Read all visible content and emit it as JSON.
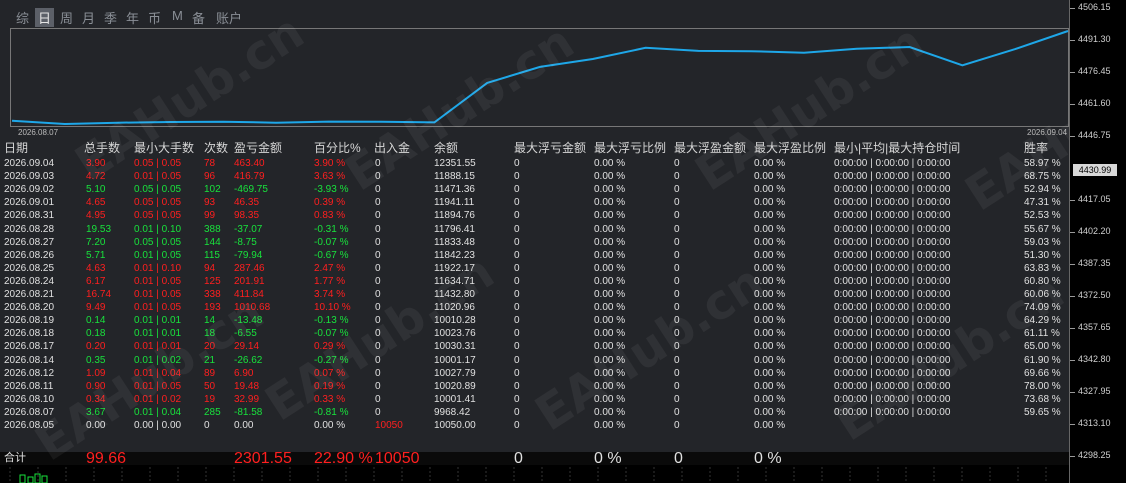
{
  "tabs": [
    "综",
    "日",
    "周",
    "月",
    "季",
    "年",
    "币",
    "M",
    "备",
    "账户"
  ],
  "active_tab": "日",
  "chart": {
    "start_date": "2026.08.07",
    "end_date": "2026.09.04",
    "line_color": "#1ea7e8"
  },
  "columns": {
    "date": "日期",
    "total_lots": "总手数",
    "min_max_lots": "最小大手数",
    "count": "次数",
    "pnl": "盈亏金额",
    "pct": "百分比%",
    "inout": "出入金",
    "balance": "余额",
    "max_float_loss": "最大浮亏金额",
    "max_float_loss_pct": "最大浮亏比例",
    "max_float_profit": "最大浮盈金额",
    "max_float_profit_pct": "最大浮盈比例",
    "hold_time": "最小|平均|最大持仓时间",
    "win_rate": "胜率"
  },
  "rows": [
    {
      "date": "2026.09.04",
      "lots": "3.90",
      "minmax": "0.05 | 0.05",
      "count": "78",
      "pnl": "463.40",
      "pct": "3.90 %",
      "inout": "0",
      "balance": "12351.55",
      "mfl": "0",
      "mflp": "0.00 %",
      "mfp": "0",
      "mfpp": "0.00 %",
      "hold": "0:00:00 | 0:00:00 | 0:00:00",
      "win": "58.97 %",
      "sign": "pos"
    },
    {
      "date": "2026.09.03",
      "lots": "4.72",
      "minmax": "0.01 | 0.05",
      "count": "96",
      "pnl": "416.79",
      "pct": "3.63 %",
      "inout": "0",
      "balance": "11888.15",
      "mfl": "0",
      "mflp": "0.00 %",
      "mfp": "0",
      "mfpp": "0.00 %",
      "hold": "0:00:00 | 0:00:00 | 0:00:00",
      "win": "68.75 %",
      "sign": "pos"
    },
    {
      "date": "2026.09.02",
      "lots": "5.10",
      "minmax": "0.05 | 0.05",
      "count": "102",
      "pnl": "-469.75",
      "pct": "-3.93 %",
      "inout": "0",
      "balance": "11471.36",
      "mfl": "0",
      "mflp": "0.00 %",
      "mfp": "0",
      "mfpp": "0.00 %",
      "hold": "0:00:00 | 0:00:00 | 0:00:00",
      "win": "52.94 %",
      "sign": "neg"
    },
    {
      "date": "2026.09.01",
      "lots": "4.65",
      "minmax": "0.05 | 0.05",
      "count": "93",
      "pnl": "46.35",
      "pct": "0.39 %",
      "inout": "0",
      "balance": "11941.11",
      "mfl": "0",
      "mflp": "0.00 %",
      "mfp": "0",
      "mfpp": "0.00 %",
      "hold": "0:00:00 | 0:00:00 | 0:00:00",
      "win": "47.31 %",
      "sign": "pos"
    },
    {
      "date": "2026.08.31",
      "lots": "4.95",
      "minmax": "0.05 | 0.05",
      "count": "99",
      "pnl": "98.35",
      "pct": "0.83 %",
      "inout": "0",
      "balance": "11894.76",
      "mfl": "0",
      "mflp": "0.00 %",
      "mfp": "0",
      "mfpp": "0.00 %",
      "hold": "0:00:00 | 0:00:00 | 0:00:00",
      "win": "52.53 %",
      "sign": "pos"
    },
    {
      "date": "2026.08.28",
      "lots": "19.53",
      "minmax": "0.01 | 0.10",
      "count": "388",
      "pnl": "-37.07",
      "pct": "-0.31 %",
      "inout": "0",
      "balance": "11796.41",
      "mfl": "0",
      "mflp": "0.00 %",
      "mfp": "0",
      "mfpp": "0.00 %",
      "hold": "0:00:00 | 0:00:00 | 0:00:00",
      "win": "55.67 %",
      "sign": "neg"
    },
    {
      "date": "2026.08.27",
      "lots": "7.20",
      "minmax": "0.05 | 0.05",
      "count": "144",
      "pnl": "-8.75",
      "pct": "-0.07 %",
      "inout": "0",
      "balance": "11833.48",
      "mfl": "0",
      "mflp": "0.00 %",
      "mfp": "0",
      "mfpp": "0.00 %",
      "hold": "0:00:00 | 0:00:00 | 0:00:00",
      "win": "59.03 %",
      "sign": "neg"
    },
    {
      "date": "2026.08.26",
      "lots": "5.71",
      "minmax": "0.01 | 0.05",
      "count": "115",
      "pnl": "-79.94",
      "pct": "-0.67 %",
      "inout": "0",
      "balance": "11842.23",
      "mfl": "0",
      "mflp": "0.00 %",
      "mfp": "0",
      "mfpp": "0.00 %",
      "hold": "0:00:00 | 0:00:00 | 0:00:00",
      "win": "51.30 %",
      "sign": "neg"
    },
    {
      "date": "2026.08.25",
      "lots": "4.63",
      "minmax": "0.01 | 0.10",
      "count": "94",
      "pnl": "287.46",
      "pct": "2.47 %",
      "inout": "0",
      "balance": "11922.17",
      "mfl": "0",
      "mflp": "0.00 %",
      "mfp": "0",
      "mfpp": "0.00 %",
      "hold": "0:00:00 | 0:00:00 | 0:00:00",
      "win": "63.83 %",
      "sign": "pos"
    },
    {
      "date": "2026.08.24",
      "lots": "6.17",
      "minmax": "0.01 | 0.05",
      "count": "125",
      "pnl": "201.91",
      "pct": "1.77 %",
      "inout": "0",
      "balance": "11634.71",
      "mfl": "0",
      "mflp": "0.00 %",
      "mfp": "0",
      "mfpp": "0.00 %",
      "hold": "0:00:00 | 0:00:00 | 0:00:00",
      "win": "60.80 %",
      "sign": "pos"
    },
    {
      "date": "2026.08.21",
      "lots": "16.74",
      "minmax": "0.01 | 0.05",
      "count": "338",
      "pnl": "411.84",
      "pct": "3.74 %",
      "inout": "0",
      "balance": "11432.80",
      "mfl": "0",
      "mflp": "0.00 %",
      "mfp": "0",
      "mfpp": "0.00 %",
      "hold": "0:00:00 | 0:00:00 | 0:00:00",
      "win": "60.06 %",
      "sign": "pos"
    },
    {
      "date": "2026.08.20",
      "lots": "9.49",
      "minmax": "0.01 | 0.05",
      "count": "193",
      "pnl": "1010.68",
      "pct": "10.10 %",
      "inout": "0",
      "balance": "11020.96",
      "mfl": "0",
      "mflp": "0.00 %",
      "mfp": "0",
      "mfpp": "0.00 %",
      "hold": "0:00:00 | 0:00:00 | 0:00:00",
      "win": "74.09 %",
      "sign": "pos"
    },
    {
      "date": "2026.08.19",
      "lots": "0.14",
      "minmax": "0.01 | 0.01",
      "count": "14",
      "pnl": "-13.48",
      "pct": "-0.13 %",
      "inout": "0",
      "balance": "10010.28",
      "mfl": "0",
      "mflp": "0.00 %",
      "mfp": "0",
      "mfpp": "0.00 %",
      "hold": "0:00:00 | 0:00:00 | 0:00:00",
      "win": "64.29 %",
      "sign": "neg"
    },
    {
      "date": "2026.08.18",
      "lots": "0.18",
      "minmax": "0.01 | 0.01",
      "count": "18",
      "pnl": "-6.55",
      "pct": "-0.07 %",
      "inout": "0",
      "balance": "10023.76",
      "mfl": "0",
      "mflp": "0.00 %",
      "mfp": "0",
      "mfpp": "0.00 %",
      "hold": "0:00:00 | 0:00:00 | 0:00:00",
      "win": "61.11 %",
      "sign": "neg"
    },
    {
      "date": "2026.08.17",
      "lots": "0.20",
      "minmax": "0.01 | 0.01",
      "count": "20",
      "pnl": "29.14",
      "pct": "0.29 %",
      "inout": "0",
      "balance": "10030.31",
      "mfl": "0",
      "mflp": "0.00 %",
      "mfp": "0",
      "mfpp": "0.00 %",
      "hold": "0:00:00 | 0:00:00 | 0:00:00",
      "win": "65.00 %",
      "sign": "pos"
    },
    {
      "date": "2026.08.14",
      "lots": "0.35",
      "minmax": "0.01 | 0.02",
      "count": "21",
      "pnl": "-26.62",
      "pct": "-0.27 %",
      "inout": "0",
      "balance": "10001.17",
      "mfl": "0",
      "mflp": "0.00 %",
      "mfp": "0",
      "mfpp": "0.00 %",
      "hold": "0:00:00 | 0:00:00 | 0:00:00",
      "win": "61.90 %",
      "sign": "neg"
    },
    {
      "date": "2026.08.12",
      "lots": "1.09",
      "minmax": "0.01 | 0.04",
      "count": "89",
      "pnl": "6.90",
      "pct": "0.07 %",
      "inout": "0",
      "balance": "10027.79",
      "mfl": "0",
      "mflp": "0.00 %",
      "mfp": "0",
      "mfpp": "0.00 %",
      "hold": "0:00:00 | 0:00:00 | 0:00:00",
      "win": "69.66 %",
      "sign": "pos"
    },
    {
      "date": "2026.08.11",
      "lots": "0.90",
      "minmax": "0.01 | 0.05",
      "count": "50",
      "pnl": "19.48",
      "pct": "0.19 %",
      "inout": "0",
      "balance": "10020.89",
      "mfl": "0",
      "mflp": "0.00 %",
      "mfp": "0",
      "mfpp": "0.00 %",
      "hold": "0:00:00 | 0:00:00 | 0:00:00",
      "win": "78.00 %",
      "sign": "pos"
    },
    {
      "date": "2026.08.10",
      "lots": "0.34",
      "minmax": "0.01 | 0.02",
      "count": "19",
      "pnl": "32.99",
      "pct": "0.33 %",
      "inout": "0",
      "balance": "10001.41",
      "mfl": "0",
      "mflp": "0.00 %",
      "mfp": "0",
      "mfpp": "0.00 %",
      "hold": "0:00:00 | 0:00:00 | 0:00:00",
      "win": "73.68 %",
      "sign": "pos"
    },
    {
      "date": "2026.08.07",
      "lots": "3.67",
      "minmax": "0.01 | 0.04",
      "count": "285",
      "pnl": "-81.58",
      "pct": "-0.81 %",
      "inout": "0",
      "balance": "9968.42",
      "mfl": "0",
      "mflp": "0.00 %",
      "mfp": "0",
      "mfpp": "0.00 %",
      "hold": "0:00:00 | 0:00:00 | 0:00:00",
      "win": "59.65 %",
      "sign": "neg"
    },
    {
      "date": "2026.08.05",
      "lots": "0.00",
      "minmax": "0.00 | 0.00",
      "count": "0",
      "pnl": "0.00",
      "pct": "0.00 %",
      "inout": "10050",
      "balance": "10050.00",
      "mfl": "0",
      "mflp": "0.00 %",
      "mfp": "0",
      "mfpp": "0.00 %",
      "hold": "",
      "win": "",
      "sign": "zero"
    }
  ],
  "total": {
    "label": "合计",
    "lots": "99.66",
    "pnl": "2301.55",
    "pct": "22.90 %",
    "inout": "10050",
    "mfl": "0",
    "mflp": "0 %",
    "mfp": "0",
    "mfpp": "0 %"
  },
  "axis": {
    "labels": [
      "4506.15",
      "4491.30",
      "4476.45",
      "4461.60",
      "4446.75",
      "4430.99",
      "4417.05",
      "4402.20",
      "4387.35",
      "4372.50",
      "4357.65",
      "4342.80",
      "4327.95",
      "4313.10",
      "4298.25"
    ],
    "current_price": "4430.99"
  },
  "watermark": "EAHub.cn"
}
